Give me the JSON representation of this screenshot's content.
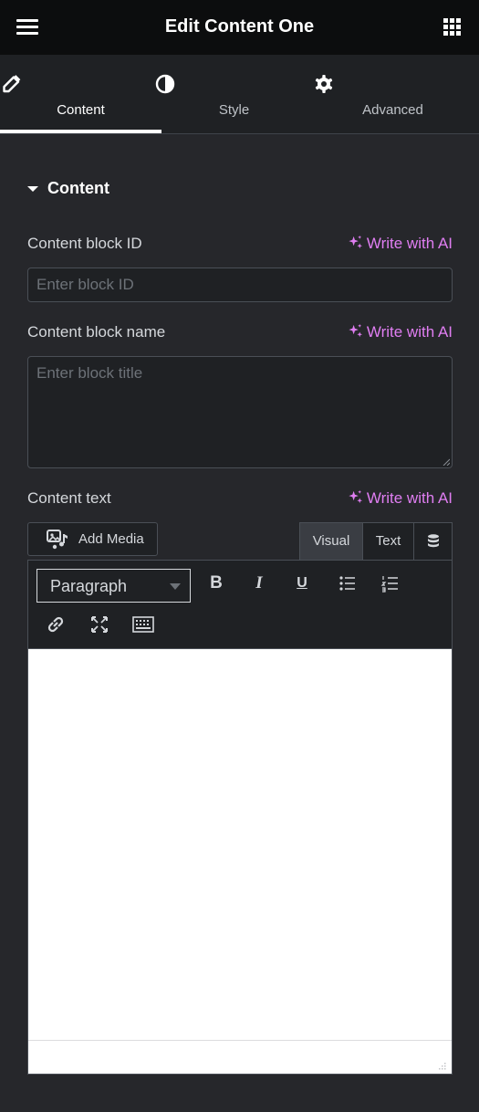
{
  "header": {
    "title": "Edit Content One",
    "menu_icon": "hamburger-icon",
    "apps_icon": "grid-icon"
  },
  "tabs": [
    {
      "label": "Content",
      "icon": "pencil-icon",
      "active": true
    },
    {
      "label": "Style",
      "icon": "half-circle-icon",
      "active": false
    },
    {
      "label": "Advanced",
      "icon": "gear-icon",
      "active": false
    }
  ],
  "section": {
    "title": "Content"
  },
  "fields": {
    "block_id": {
      "label": "Content block ID",
      "ai": "Write with AI",
      "placeholder": "Enter block ID",
      "value": ""
    },
    "block_name": {
      "label": "Content block name",
      "ai": "Write with AI",
      "placeholder": "Enter block title",
      "value": ""
    },
    "content_text": {
      "label": "Content text",
      "ai": "Write with AI"
    }
  },
  "editor": {
    "add_media": "Add Media",
    "tabs": {
      "visual": "Visual",
      "text": "Text"
    },
    "format": "Paragraph",
    "buttons": {
      "bold": "B",
      "italic": "I",
      "underline": "U"
    }
  },
  "colors": {
    "accent_ai": "#e07ef2",
    "panel_bg": "#26272b",
    "header_bg": "#0c0d0e"
  }
}
